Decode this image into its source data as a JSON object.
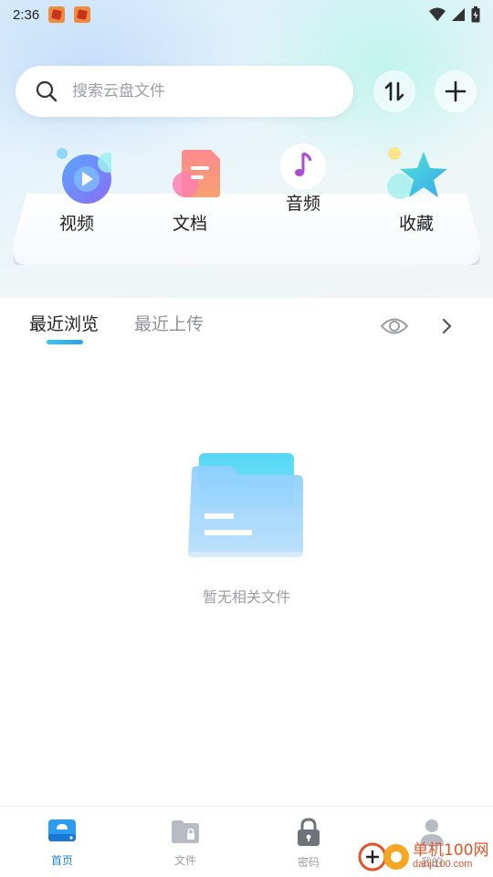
{
  "status_bar": {
    "time": "2:36"
  },
  "search": {
    "placeholder": "搜索云盘文件"
  },
  "categories": [
    {
      "label": "视频",
      "icon": "video-icon"
    },
    {
      "label": "文档",
      "icon": "document-icon"
    },
    {
      "label": "音频",
      "icon": "music-icon"
    },
    {
      "label": "收藏",
      "icon": "star-icon"
    }
  ],
  "tabs": [
    {
      "label": "最近浏览",
      "active": true
    },
    {
      "label": "最近上传",
      "active": false
    }
  ],
  "empty_state": {
    "text": "暂无相关文件"
  },
  "bottom_nav": [
    {
      "label": "首页",
      "active": true
    },
    {
      "label": "文件",
      "active": false
    },
    {
      "label": "密码",
      "active": false
    },
    {
      "label": "我的",
      "active": false
    }
  ],
  "watermark": {
    "line1": "单机100网",
    "line2": "danji100.com"
  },
  "colors": {
    "accent": "#1a86d8",
    "tab_indicator": "#2ea0ec",
    "muted_text": "#9a9ea4"
  }
}
